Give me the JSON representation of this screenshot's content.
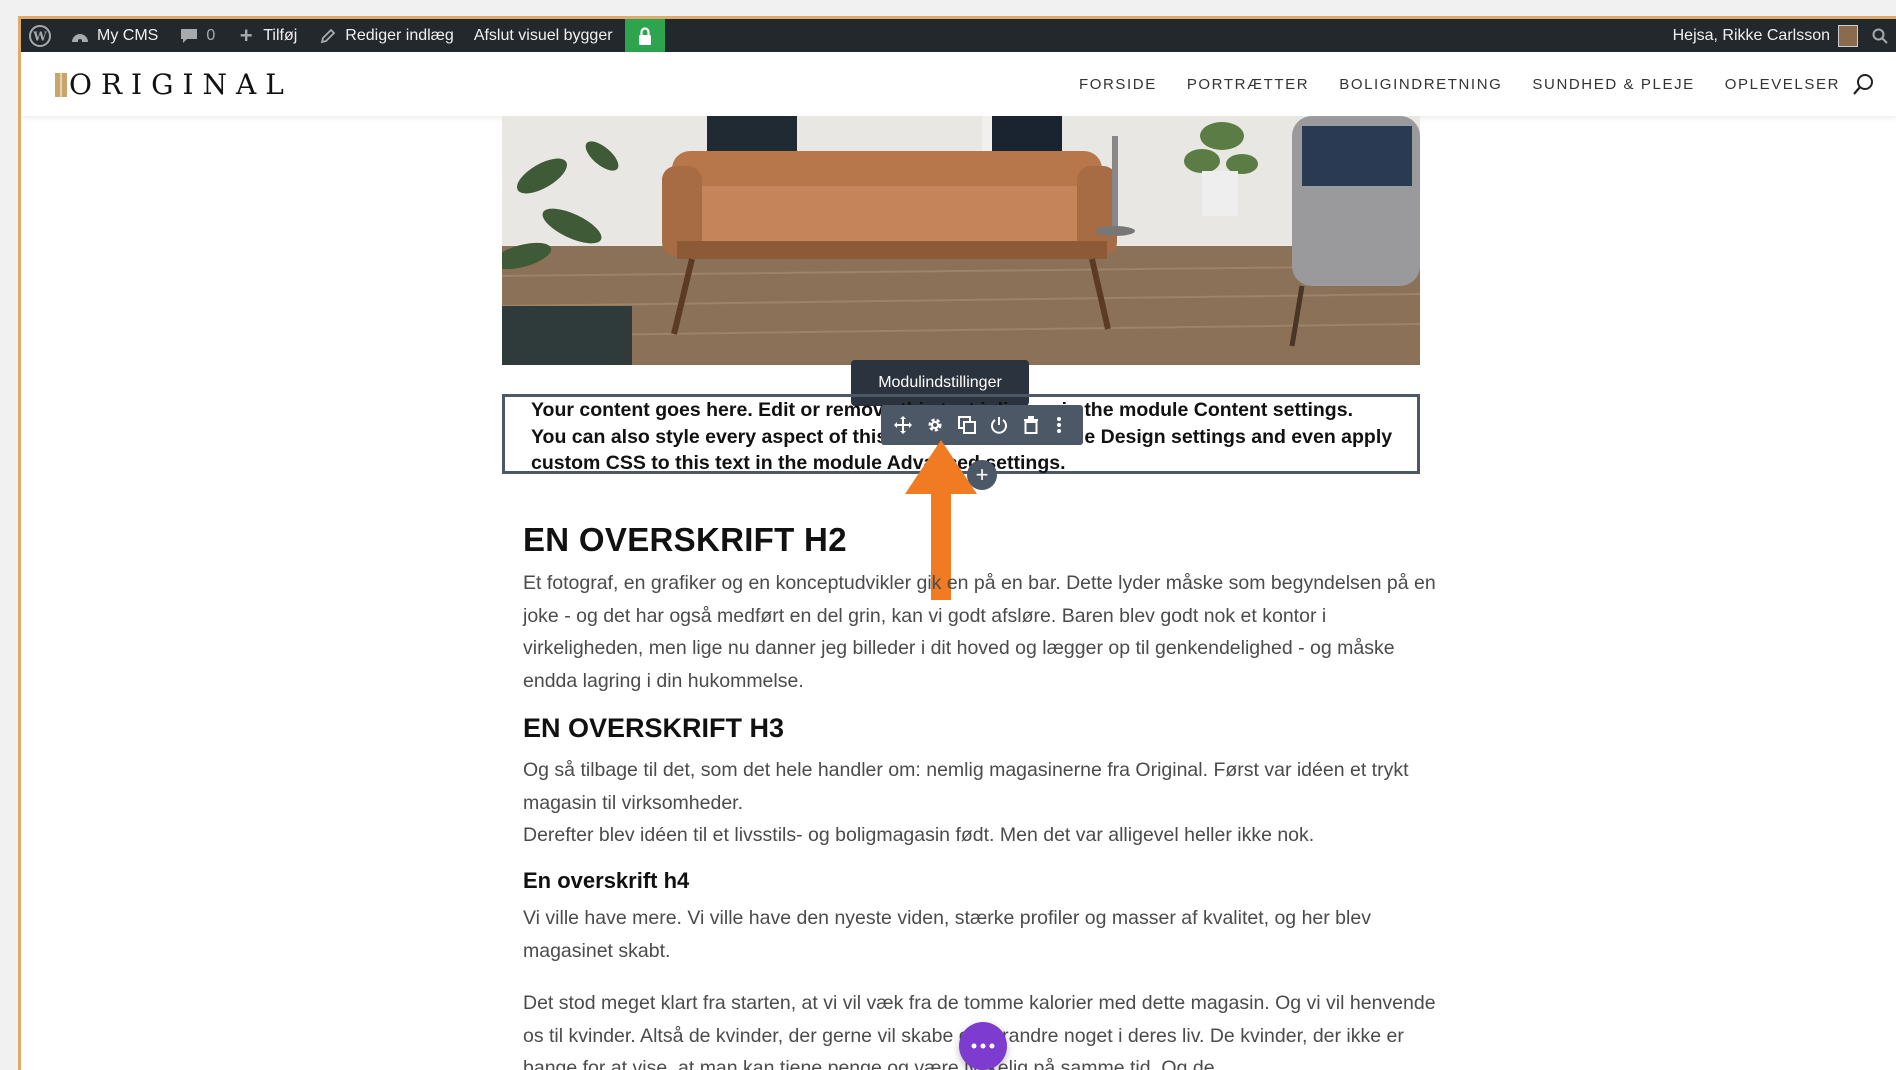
{
  "adminbar": {
    "site_name": "My CMS",
    "comments_count": "0",
    "add_label": "Tilføj",
    "edit_post_label": "Rediger indlæg",
    "exit_builder_label": "Afslut visuel bygger",
    "greeting": "Hejsa, Rikke Carlsson"
  },
  "header": {
    "logo_text": "ORIGINAL",
    "nav": [
      "FORSIDE",
      "PORTRÆTTER",
      "BOLIGINDRETNING",
      "SUNDHED & PLEJE",
      "OPLEVELSER"
    ]
  },
  "module": {
    "tooltip": "Modulindstillinger",
    "lines": [
      "Your content goes here. Edit or remove this text inline or in the module Content settings.",
      "You can also style every aspect of this content in the module Design settings and even apply",
      "custom CSS to this text in the module Advanced settings."
    ],
    "toolbar_icons": [
      "move-icon",
      "gear-icon",
      "duplicate-icon",
      "power-icon",
      "trash-icon",
      "more-icon"
    ]
  },
  "content": {
    "h2": "EN OVERSKRIFT H2",
    "p1": "Et fotograf, en grafiker og en konceptudvikler gik en på en bar. Dette lyder måske som begyndelsen på en joke - og det har også medført en del grin, kan vi godt afsløre. Baren blev godt nok et kontor i virkeligheden, men lige nu danner jeg billeder i dit hoved og lægger op til genkendelighed - og måske endda lagring i din hukommelse.",
    "h3": "EN OVERSKRIFT H3",
    "p2a": "Og så tilbage til det, som det hele handler om: nemlig magasinerne fra Original. Først var idéen et trykt magasin til virksomheder.",
    "p2b": "Derefter blev idéen til et livsstils- og boligmagasin født. Men det var alligevel heller ikke nok.",
    "h4": "En overskrift h4",
    "p3": "Vi ville have mere. Vi ville have den nyeste viden, stærke profiler og masser af kvalitet, og her blev magasinet skabt.",
    "p4": "Det stod meget klart fra starten, at vi vil væk fra de tomme kalorier med dette magasin. Og vi vil henvende os til kvinder. Altså de kvinder, der gerne vil skabe og forandre noget i deres liv. De kvinder, der ikke er bange for at vise, at man kan tjene penge og være lykkelig på samme tid. Og de"
  },
  "colors": {
    "adminbar": "#23282d",
    "lock_green": "#2ea44f",
    "arrow_orange": "#f07b22",
    "fab_purple": "#7e3bd0",
    "module_border": "#4c5866"
  }
}
